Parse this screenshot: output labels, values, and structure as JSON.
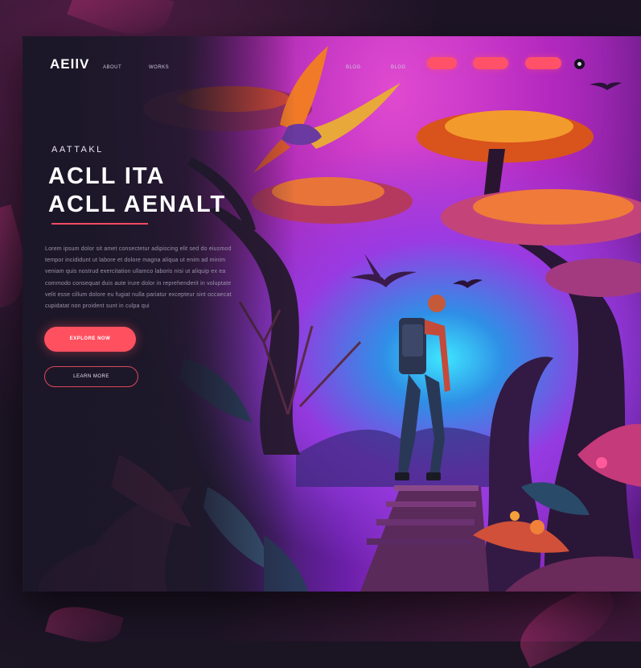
{
  "brand": {
    "logo_text": "AEllV"
  },
  "nav": {
    "links": [
      "ABOUT",
      "WORKS",
      "BLOG",
      "BLOG"
    ],
    "buttons": [
      "",
      "",
      ""
    ]
  },
  "hero": {
    "eyebrow": "AATTAKL",
    "headline_line1": "ACLL ITA",
    "headline_line2": "ACLL AENALT",
    "paragraph": "Lorem ipsum dolor sit amet consectetur adipiscing elit sed do eiusmod tempor incididunt ut labore et dolore magna aliqua ut enim ad minim veniam quis nostrud exercitation ullamco laboris nisi ut aliquip ex ea commodo consequat duis aute irure dolor in reprehenderit in voluptate velit esse cillum dolore eu fugiat nulla pariatur excepteur sint occaecat cupidatat non proident sunt in culpa qui",
    "primary_button": "EXPLORE NOW",
    "secondary_button": "LEARN MORE"
  },
  "colors": {
    "accent": "#ff5268",
    "panel": "#1f1a2b",
    "glow": "#3ee6ff"
  },
  "icons": [
    "moon-icon"
  ]
}
